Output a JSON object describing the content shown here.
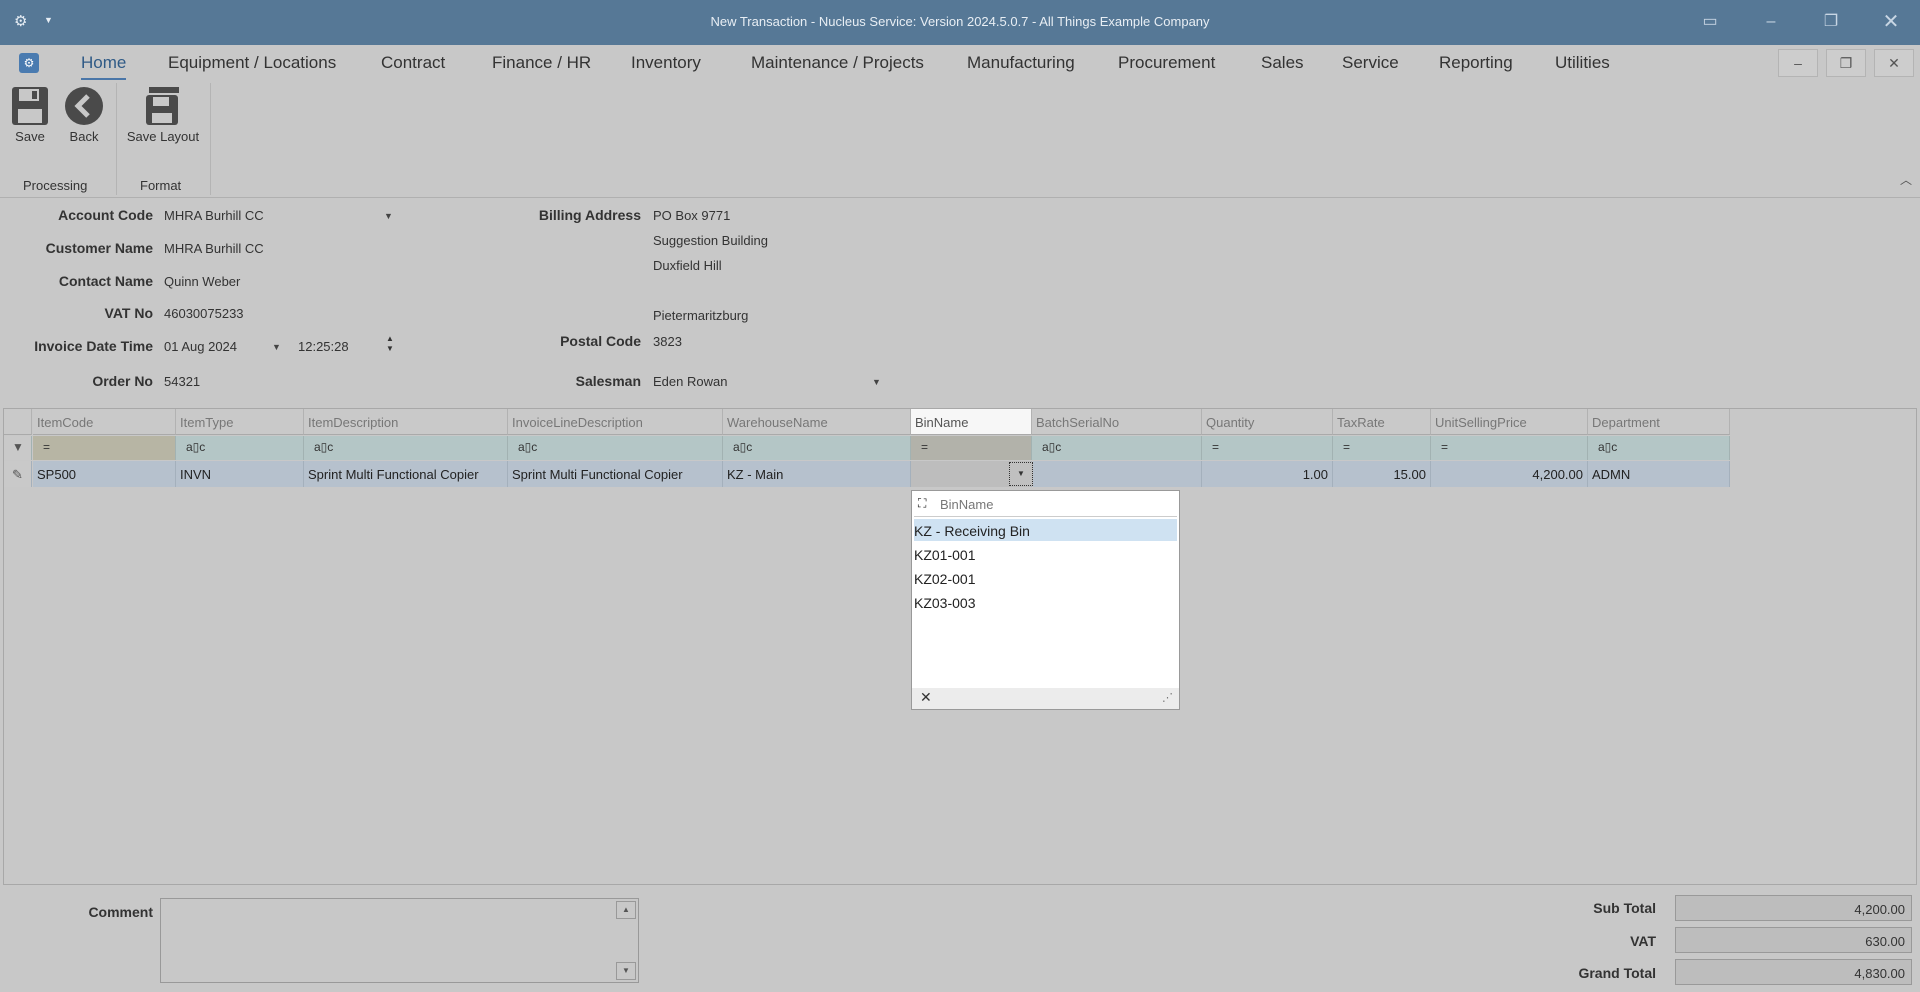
{
  "window": {
    "title": "New Transaction - Nucleus Service: Version 2024.5.0.7 - All Things Example Company"
  },
  "menu": {
    "tabs": [
      "Home",
      "Equipment / Locations",
      "Contract",
      "Finance / HR",
      "Inventory",
      "Maintenance / Projects",
      "Manufacturing",
      "Procurement",
      "Sales",
      "Service",
      "Reporting",
      "Utilities"
    ]
  },
  "ribbon": {
    "save": "Save",
    "back": "Back",
    "save_layout": "Save Layout",
    "group_processing": "Processing",
    "group_format": "Format"
  },
  "form": {
    "account_code_label": "Account Code",
    "account_code": "MHRA Burhill CC",
    "customer_name_label": "Customer Name",
    "customer_name": "MHRA Burhill CC",
    "contact_name_label": "Contact Name",
    "contact_name": "Quinn Weber",
    "vat_no_label": "VAT No",
    "vat_no": "46030075233",
    "invoice_dt_label": "Invoice Date Time",
    "invoice_date": "01 Aug 2024",
    "invoice_time": "12:25:28",
    "order_no_label": "Order No",
    "order_no": "54321",
    "billing_address_label": "Billing Address",
    "billing_line1": "PO Box 9771",
    "billing_line2": "Suggestion Building",
    "billing_line3": "Duxfield Hill",
    "billing_line4": "Pietermaritzburg",
    "postal_code_label": "Postal Code",
    "postal_code": "3823",
    "salesman_label": "Salesman",
    "salesman": "Eden Rowan"
  },
  "grid": {
    "columns": [
      "ItemCode",
      "ItemType",
      "ItemDescription",
      "InvoiceLineDescription",
      "WarehouseName",
      "BinName",
      "BatchSerialNo",
      "Quantity",
      "TaxRate",
      "UnitSellingPrice",
      "Department"
    ],
    "filter_eq": "=",
    "filter_like": "a▯c",
    "row": {
      "ItemCode": "SP500",
      "ItemType": "INVN",
      "ItemDescription": "Sprint Multi Functional Copier",
      "InvoiceLineDescription": "Sprint Multi Functional Copier",
      "WarehouseName": "KZ - Main",
      "BinName": "",
      "BatchSerialNo": "",
      "Quantity": "1.00",
      "TaxRate": "15.00",
      "UnitSellingPrice": "4,200.00",
      "Department": "ADMN"
    }
  },
  "bin_popup": {
    "search_placeholder": "BinName",
    "items": [
      "KZ - Receiving Bin",
      "KZ01-001",
      "KZ02-001",
      "KZ03-003"
    ],
    "highlighted": 0
  },
  "footer": {
    "comment_label": "Comment",
    "sub_total_label": "Sub Total",
    "sub_total": "4,200.00",
    "vat_label": "VAT",
    "vat": "630.00",
    "grand_total_label": "Grand Total",
    "grand_total": "4,830.00"
  },
  "colors": {
    "titlebar": "#567896",
    "row_bg": "#b6c1cd",
    "highlight": "#cfe2f2"
  }
}
